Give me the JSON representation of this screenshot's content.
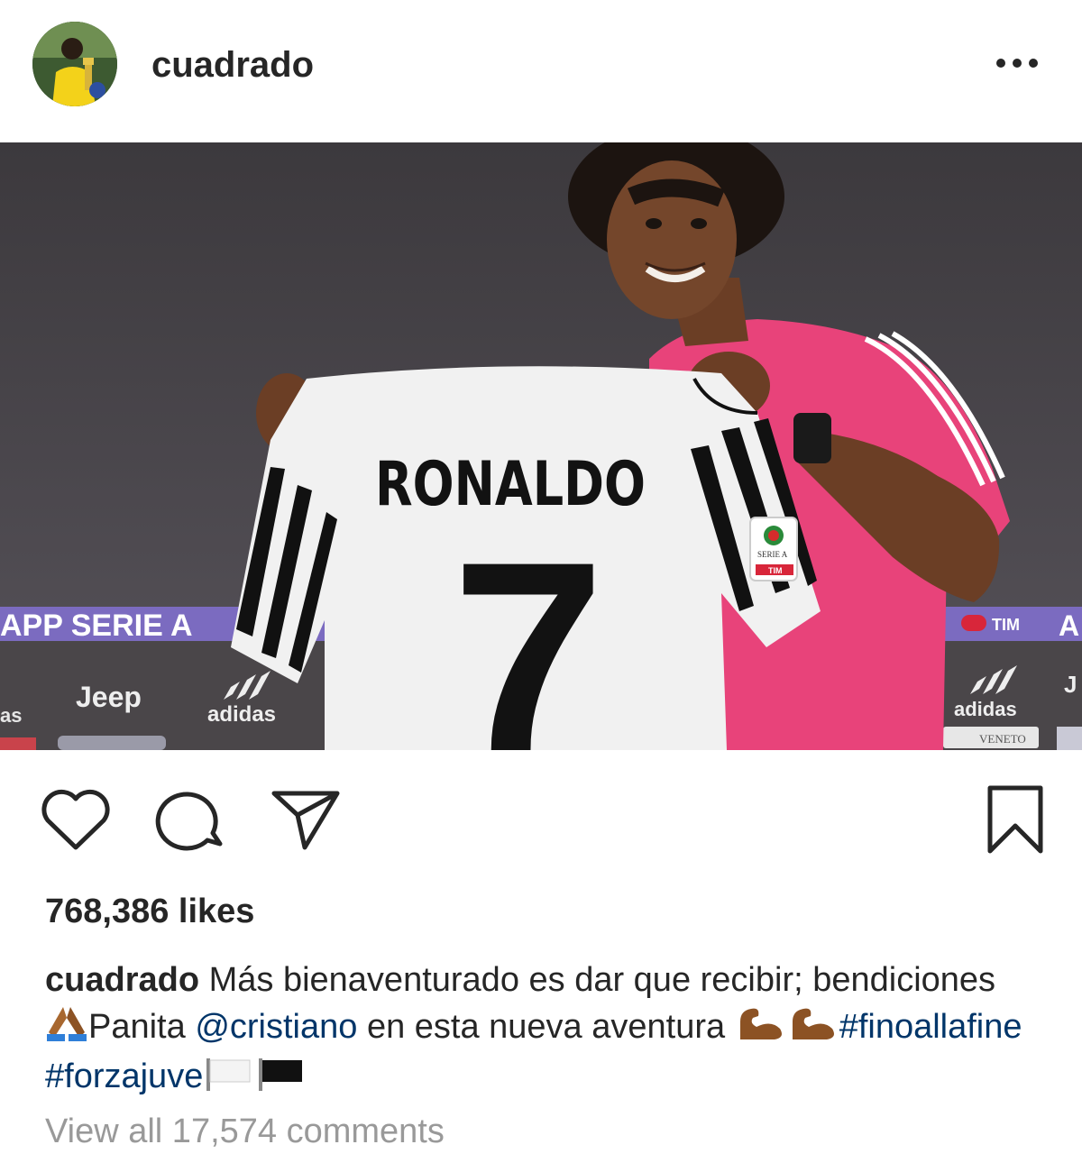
{
  "post": {
    "username": "cuadrado",
    "more_icon": "ellipsis-icon",
    "image": {
      "jersey_name": "RONALDO",
      "jersey_number": "7",
      "banner_left": "APP SERIE A",
      "banner_right_tim": "TIM",
      "banner_right_letter": "A",
      "sponsor_jeep": "Jeep",
      "sponsor_adidas": "adidas",
      "sponsor_left_fragment": "as",
      "patch_serie": "SERIE A",
      "patch_tim": "TIM",
      "sponsor_veneto": "VENETO"
    },
    "actions": {
      "like_icon": "heart-icon",
      "comment_icon": "comment-icon",
      "share_icon": "send-icon",
      "save_icon": "bookmark-icon"
    },
    "likes_text": "768,386 likes",
    "caption": {
      "username": "cuadrado",
      "text1": "Más bienaventurado es dar que recibir; bendiciones ",
      "text2": "Panita ",
      "mention": "@cristiano",
      "text3": " en esta nueva aventura ",
      "hashtag1": "#finoallafine",
      "hashtag2": "#forzajuve"
    },
    "view_comments": "View all 17,574 comments"
  }
}
